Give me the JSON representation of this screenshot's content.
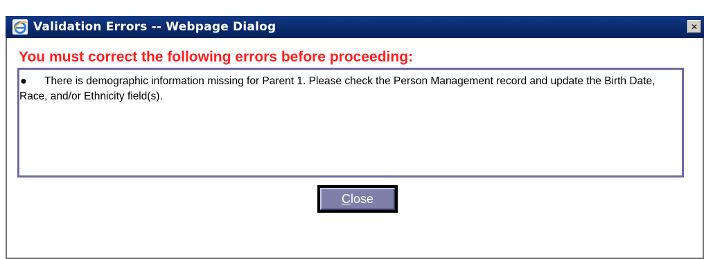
{
  "window": {
    "title": "Validation Errors -- Webpage Dialog",
    "app_icon": "internet-explorer-icon",
    "close_glyph": "✕"
  },
  "dialog": {
    "heading": "You must correct the following errors before proceeding:",
    "errors": [
      {
        "bullet": "●",
        "text": "There is demographic information missing for Parent 1. Please check the Person Management record and update the Birth Date, Race, and/or Ethnicity field(s)."
      }
    ],
    "close_button": {
      "accelerator": "C",
      "rest": "lose"
    }
  },
  "colors": {
    "titlebar": "#0a2a6b",
    "heading": "#ff2020",
    "error_box_border": "#6c6a9e",
    "button_face": "#7f7faa"
  }
}
